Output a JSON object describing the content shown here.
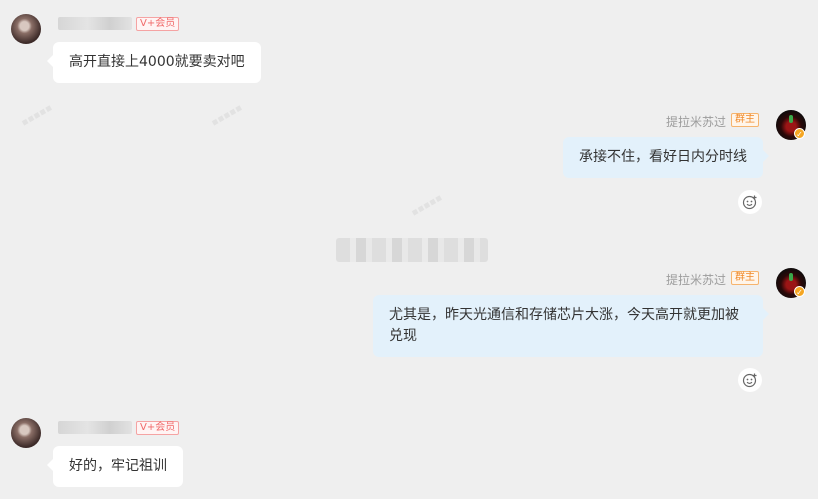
{
  "messages": [
    {
      "side": "left",
      "user": {
        "name_blurred": true,
        "badge": "V+会员"
      },
      "text": "高开直接上4000就要卖对吧"
    },
    {
      "side": "right",
      "user": {
        "name": "提拉米苏过",
        "badge": "群主"
      },
      "text": "承接不住，看好日内分时线"
    },
    {
      "side": "right",
      "user": {
        "name": "提拉米苏过",
        "badge": "群主"
      },
      "text": "尤其是，昨天光通信和存储芯片大涨，今天高开就更加被兑现"
    },
    {
      "side": "left",
      "user": {
        "name_blurred": true,
        "badge": "V+会员"
      },
      "text": "好的，牢记祖训"
    }
  ],
  "icons": {
    "reaction": "emoji-add-icon",
    "verified": "v-badge-icon"
  },
  "colors": {
    "background": "#efefef",
    "left_bubble": "#ffffff",
    "right_bubble": "#e3f1fb",
    "vip": "#f06a6a",
    "owner": "#f08a2a"
  }
}
